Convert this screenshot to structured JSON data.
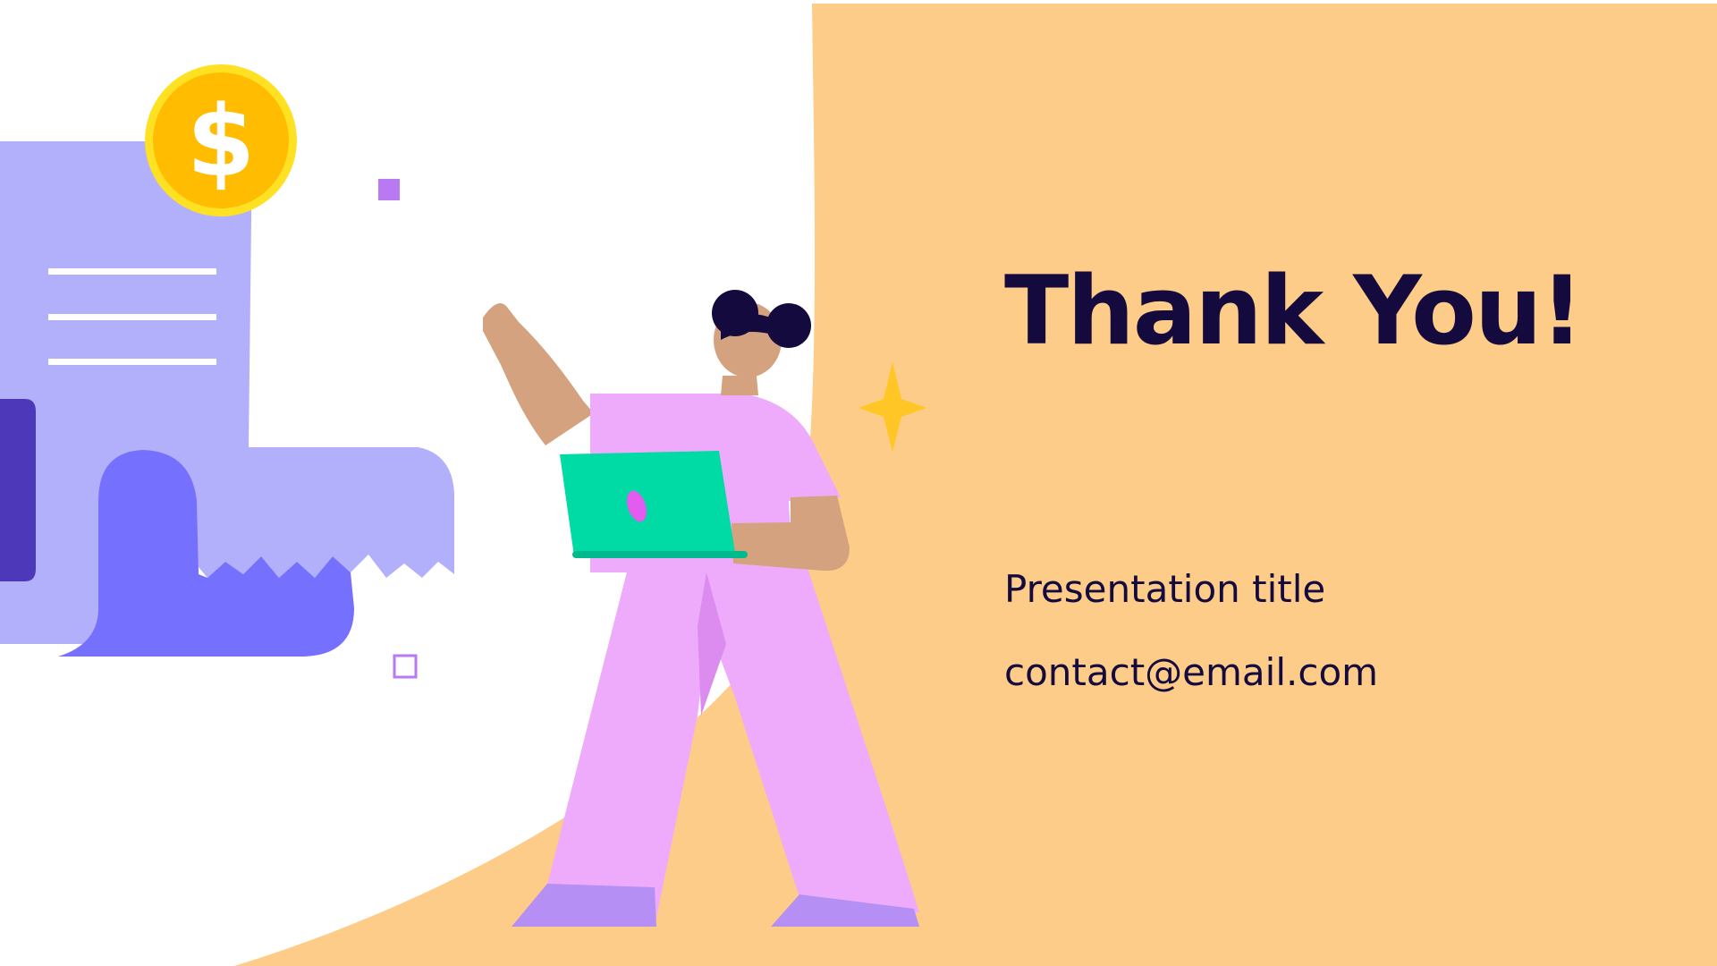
{
  "slide": {
    "title": "Thank You!",
    "subtitle": "Presentation title",
    "contact": "contact@email.com"
  },
  "icons": {
    "coin": "dollar-coin-icon",
    "receipt": "receipt-icon",
    "sparkle": "sparkle-icon",
    "person": "person-with-laptop-illustration"
  },
  "colors": {
    "background_panel": "#FDCC88",
    "text": "#140A3E",
    "coin": "#FFBC00",
    "coin_rim": "#FFE124",
    "receipt": "#B3B0FB",
    "receipt_shadow": "#7670FE",
    "receipt_dark": "#4E38BA",
    "shirt": "#EEABFC",
    "laptop": "#00DAA4",
    "skin": "#D5A280",
    "hair": "#140A3E",
    "shoes": "#B58FF3",
    "sparkle": "#FFC625"
  },
  "coin_symbol": "$"
}
